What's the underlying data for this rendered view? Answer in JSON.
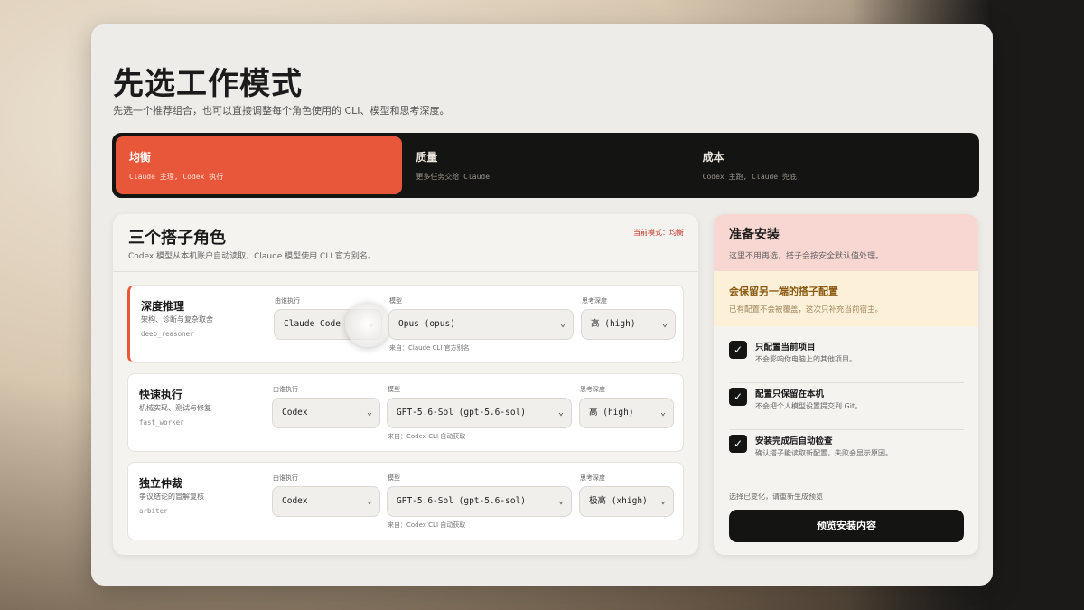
{
  "header": {
    "title": "先选工作模式",
    "subtitle": "先选一个推荐组合，也可以直接调整每个角色使用的 CLI、模型和思考深度。"
  },
  "modes": [
    {
      "name": "均衡",
      "desc": "Claude 主理, Codex 执行",
      "active": true
    },
    {
      "name": "质量",
      "desc": "更多任务交给 Claude",
      "active": false
    },
    {
      "name": "成本",
      "desc": "Codex 主跑, Claude 兜底",
      "active": false
    }
  ],
  "roles_panel": {
    "title": "三个搭子角色",
    "subtitle": "Codex 模型从本机账户自动读取，Claude 模型使用 CLI 官方别名。",
    "current_mode": "当前模式：均衡",
    "label_executor": "由谁执行",
    "label_model": "模型",
    "label_depth": "思考深度"
  },
  "roles": [
    {
      "name": "深度推理",
      "desc": "架构、诊断与复杂取舍",
      "id": "deep_reasoner",
      "executor": "Claude Code",
      "model": "Opus (opus)",
      "depth": "高 (high)",
      "source": "来自：Claude CLI 官方别名"
    },
    {
      "name": "快速执行",
      "desc": "机械实现、测试与修复",
      "id": "fast_worker",
      "executor": "Codex",
      "model": "GPT-5.6-Sol (gpt-5.6-sol)",
      "depth": "高 (high)",
      "source": "来自：Codex CLI 自动获取"
    },
    {
      "name": "独立仲裁",
      "desc": "争议结论的盲解复核",
      "id": "arbiter",
      "executor": "Codex",
      "model": "GPT-5.6-Sol (gpt-5.6-sol)",
      "depth": "极高 (xhigh)",
      "source": "来自：Codex CLI 自动获取"
    }
  ],
  "install_panel": {
    "title": "准备安装",
    "subtitle": "这里不用再选，搭子会按安全默认值处理。",
    "warn_title": "会保留另一端的搭子配置",
    "warn_sub": "已有配置不会被覆盖，这次只补充当前宿主。",
    "checks": [
      {
        "title": "只配置当前项目",
        "sub": "不会影响你电脑上的其他项目。"
      },
      {
        "title": "配置只保留在本机",
        "sub": "不会把个人模型设置提交到 Git。"
      },
      {
        "title": "安装完成后自动检查",
        "sub": "确认搭子能读取新配置，失败会显示原因。"
      }
    ],
    "note": "选择已变化，请重新生成预览",
    "button": "预览安装内容"
  },
  "icons": {
    "chevron": "chevron-down-icon",
    "check": "check-icon"
  },
  "colors": {
    "accent": "#e8573a",
    "dark": "#141412",
    "warn_bg": "#fdf0d8",
    "head_bg": "#f8d6d1"
  }
}
